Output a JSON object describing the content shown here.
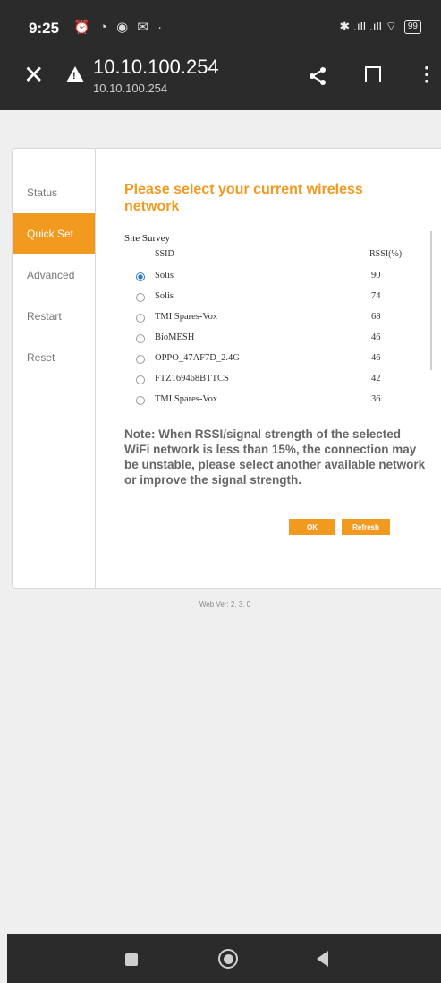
{
  "status_bar": {
    "time": "9:25",
    "left_icons": "⏰ ◔ ◉ ✉ ·",
    "right_icons": "✱ .ıll .ıll ⌔",
    "battery": "99"
  },
  "browser": {
    "url_title": "10.10.100.254",
    "url_sub": "10.10.100.254",
    "close_glyph": "✕",
    "menu_glyph": "⋮"
  },
  "sidebar": {
    "items": [
      {
        "label": "Status",
        "active": false
      },
      {
        "label": "Quick Set",
        "active": true
      },
      {
        "label": "Advanced",
        "active": false
      },
      {
        "label": "Restart",
        "active": false
      },
      {
        "label": "Reset",
        "active": false
      }
    ]
  },
  "main": {
    "heading": "Please select your current wireless network",
    "survey_label": "Site Survey",
    "col_ssid": "SSID",
    "col_rssi": "RSSI(%)",
    "networks": [
      {
        "ssid": "Solis",
        "rssi": "90",
        "selected": true
      },
      {
        "ssid": "Solis",
        "rssi": "74",
        "selected": false
      },
      {
        "ssid": "TMI Spares-Vox",
        "rssi": "68",
        "selected": false
      },
      {
        "ssid": "BioMESH",
        "rssi": "46",
        "selected": false
      },
      {
        "ssid": "OPPO_47AF7D_2.4G",
        "rssi": "46",
        "selected": false
      },
      {
        "ssid": "FTZ169468BTTCS",
        "rssi": "42",
        "selected": false
      },
      {
        "ssid": "TMI Spares-Vox",
        "rssi": "36",
        "selected": false
      }
    ],
    "note": "Note: When RSSI/signal strength of the selected WiFi network is less than 15%, the connection may be unstable, please select another available network or improve the signal strength.",
    "ok_label": "OK",
    "refresh_label": "Refresh"
  },
  "footer": {
    "web_version": "Web Ver: 2. 3. 0"
  },
  "colors": {
    "accent": "#f29a1f",
    "topbar": "#2b2b2b",
    "radio_checked": "#2f78d8"
  }
}
